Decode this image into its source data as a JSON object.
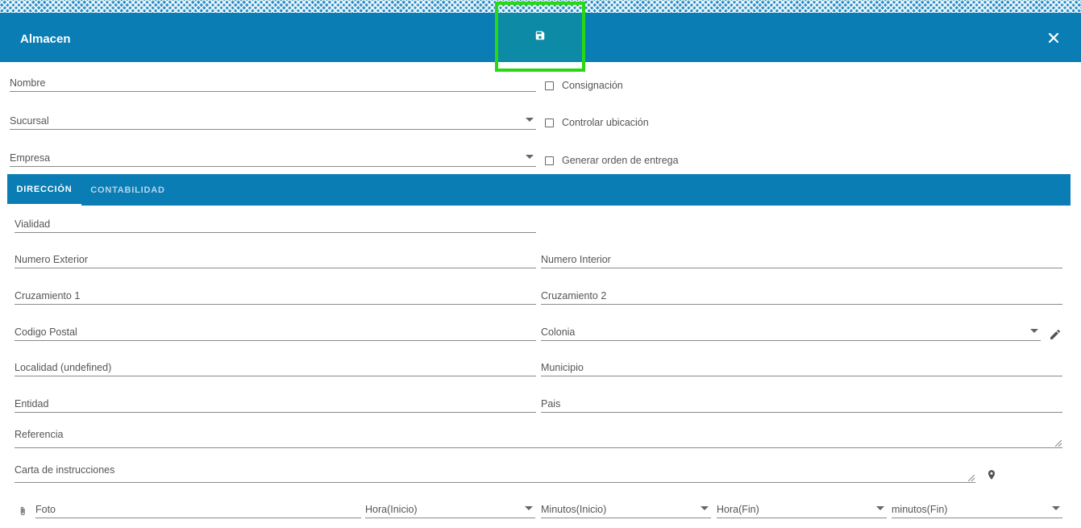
{
  "window": {
    "title": "Almacen",
    "save_icon": "save-icon",
    "close_icon": "close-icon"
  },
  "colors": {
    "header": "#0a7db5",
    "save_button": "#0d8aa6",
    "highlight": "#27d912"
  },
  "form": {
    "nombre": "Nombre",
    "sucursal": "Sucursal",
    "empresa": "Empresa",
    "checkboxes": {
      "consignacion": "Consignación",
      "controlar_ubicacion": "Controlar ubicación",
      "generar_orden": "Generar orden de entrega"
    }
  },
  "tabs": {
    "direccion": "DIRECCIÓN",
    "contabilidad": "CONTABILIDAD",
    "active": "direccion"
  },
  "address": {
    "vialidad": "Vialidad",
    "numero_exterior": "Numero Exterior",
    "numero_interior": "Numero Interior",
    "cruzamiento_1": "Cruzamiento 1",
    "cruzamiento_2": "Cruzamiento 2",
    "codigo_postal": "Codigo Postal",
    "colonia": "Colonia",
    "localidad": "Localidad (undefined)",
    "municipio": "Municipio",
    "entidad": "Entidad",
    "pais": "Pais",
    "referencia": "Referencia",
    "carta_instrucciones": "Carta de instrucciones",
    "foto": "Foto",
    "hora_inicio": "Hora(Inicio)",
    "minutos_inicio": "Minutos(Inicio)",
    "hora_fin": "Hora(Fin)",
    "minutos_fin": "minutos(Fin)"
  }
}
